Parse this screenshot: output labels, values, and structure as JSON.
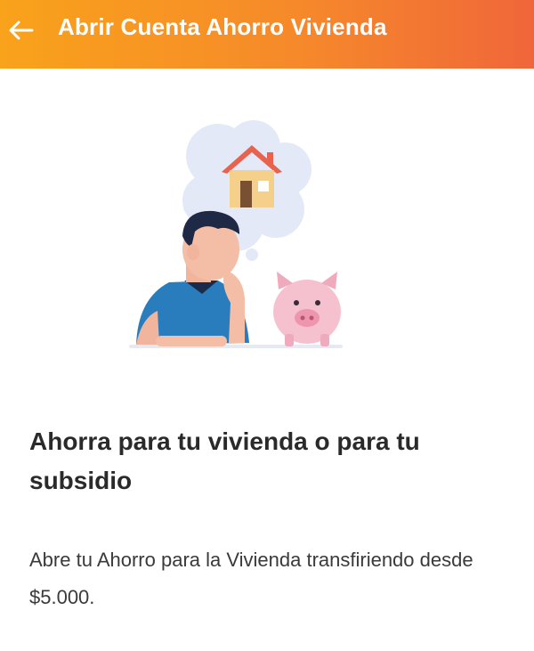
{
  "header": {
    "title": "Abrir Cuenta Ahorro Vivienda",
    "back_icon": "arrow-left-icon",
    "gradient_start": "#f9a21b",
    "gradient_end": "#f0663a"
  },
  "content": {
    "heading": "Ahorra para tu vivienda o para tu subsidio",
    "description": "Abre tu Ahorro para la Vivienda transfiriendo desde $5.000."
  },
  "illustration": {
    "icons": [
      "house-icon",
      "thought-bubble",
      "person-thinking",
      "piggy-bank-icon"
    ]
  }
}
